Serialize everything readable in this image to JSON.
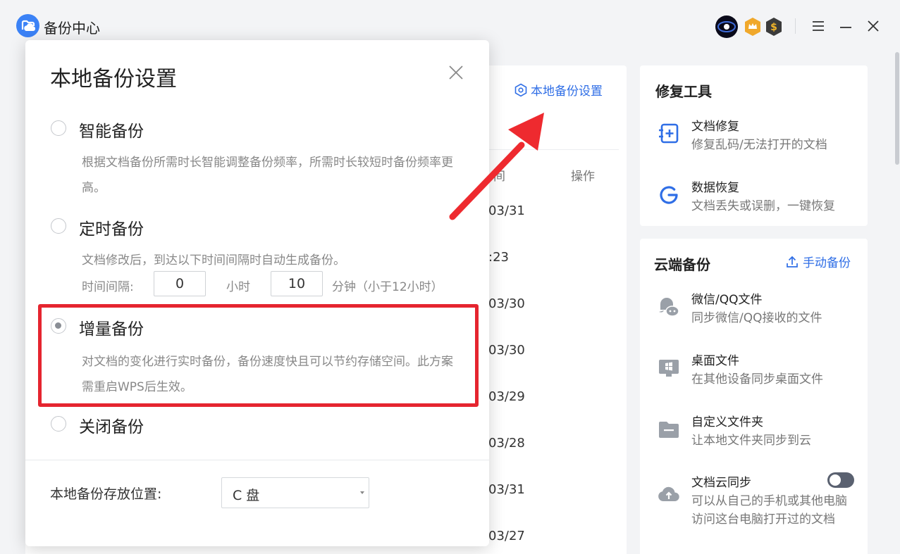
{
  "app": {
    "title": "备份中心"
  },
  "main": {
    "local_settings_link": "本地备份设置",
    "col_time": "间",
    "col_action": "操作",
    "dates": [
      "03/31",
      ":23",
      "03/30",
      "03/30",
      "03/29",
      "03/28",
      "03/31",
      "03/27"
    ]
  },
  "repair": {
    "title": "修复工具",
    "items": [
      {
        "title": "文档修复",
        "desc": "修复乱码/无法打开的文档",
        "icon": "document-repair-icon"
      },
      {
        "title": "数据恢复",
        "desc": "文档丢失或误删，一键恢复",
        "icon": "data-recovery-icon"
      }
    ]
  },
  "cloud": {
    "title": "云端备份",
    "manual_backup": "手动备份",
    "items": [
      {
        "title": "微信/QQ文件",
        "desc": "同步微信/QQ接收的文件",
        "icon": "chat-icon"
      },
      {
        "title": "桌面文件",
        "desc": "在其他设备同步桌面文件",
        "icon": "desktop-icon"
      },
      {
        "title": "自定义文件夹",
        "desc": "让本地文件夹同步到云",
        "icon": "folder-icon"
      },
      {
        "title": "文档云同步",
        "desc": "可以从自己的手机或其他电脑",
        "desc2": "访问这台电脑打开过的文档",
        "icon": "cloud-upload-icon",
        "toggle_on": false
      }
    ]
  },
  "dialog": {
    "title": "本地备份设置",
    "selected": "增量备份",
    "options": {
      "smart": {
        "label": "智能备份",
        "desc": "根据文档备份所需时长智能调整备份频率，所需时长较短时备份频率更高。"
      },
      "timed": {
        "label": "定时备份",
        "desc": "文档修改后，到达以下时间间隔时自动生成备份。",
        "interval_label": "时间间隔:",
        "hours_value": "0",
        "hours_unit": "小时",
        "minutes_value": "10",
        "minutes_unit": "分钟（小于12小时）"
      },
      "incremental": {
        "label": "增量备份",
        "desc": "对文档的变化进行实时备份，备份速度快且可以节约存储空间。此方案需重启WPS后生效。"
      },
      "off": {
        "label": "关闭备份"
      }
    },
    "location_label": "本地备份存放位置:",
    "location_value": "C 盘"
  },
  "colors": {
    "accent": "#2f6ee6",
    "highlight": "#e5252f",
    "arrow": "#ee2a2f"
  }
}
